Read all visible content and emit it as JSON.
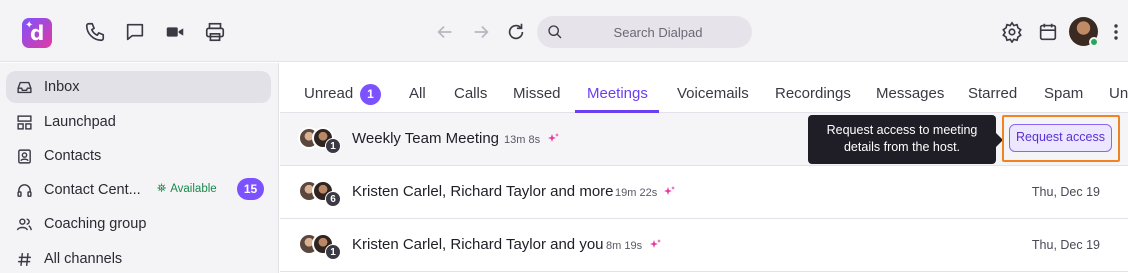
{
  "app": {
    "logo_letter": "d",
    "brand_colors": [
      "#7c52ff",
      "#e23aa2"
    ]
  },
  "toolbar": {
    "icons": [
      "phone-icon",
      "chat-icon",
      "video-icon",
      "printer-icon"
    ],
    "nav_icons": [
      "back-arrow-icon",
      "forward-arrow-icon",
      "refresh-icon"
    ],
    "search_placeholder": "Search Dialpad",
    "right_icons": [
      "settings-icon",
      "calendar-icon",
      "avatar",
      "more-icon"
    ]
  },
  "sidebar": {
    "items": [
      {
        "label": "Inbox",
        "icon": "inbox-icon",
        "active": true
      },
      {
        "label": "Launchpad",
        "icon": "launchpad-icon"
      },
      {
        "label": "Contacts",
        "icon": "contacts-icon"
      },
      {
        "label": "Contact Cent...",
        "icon": "headset-icon",
        "status": "Available",
        "badge": "15"
      },
      {
        "label": "Coaching group",
        "icon": "people-icon"
      },
      {
        "label": "All channels",
        "icon": "hash-icon"
      }
    ]
  },
  "tabs": [
    {
      "label": "Unread",
      "count": "1"
    },
    {
      "label": "All"
    },
    {
      "label": "Calls"
    },
    {
      "label": "Missed"
    },
    {
      "label": "Meetings",
      "active": true
    },
    {
      "label": "Voicemails"
    },
    {
      "label": "Recordings"
    },
    {
      "label": "Messages"
    },
    {
      "label": "Starred"
    },
    {
      "label": "Spam"
    },
    {
      "label": "Un"
    }
  ],
  "rows": [
    {
      "title": "Weekly Team Meeting",
      "duration": "13m 8s",
      "participants_extra": "1",
      "date": ""
    },
    {
      "title": "Kristen Carlel, Richard Taylor and more",
      "duration": "19m 22s",
      "participants_extra": "6",
      "date": "Thu, Dec 19"
    },
    {
      "title": "Kristen Carlel, Richard Taylor and you",
      "duration": "8m 19s",
      "participants_extra": "1",
      "date": "Thu, Dec 19"
    }
  ],
  "tooltip": {
    "line1": "Request access to meeting",
    "line2": "details from the host."
  },
  "request_button": {
    "label": "Request access"
  },
  "colors": {
    "accent": "#6b3ff2",
    "highlight_border": "#f08324",
    "available": "#1a8a4a"
  }
}
